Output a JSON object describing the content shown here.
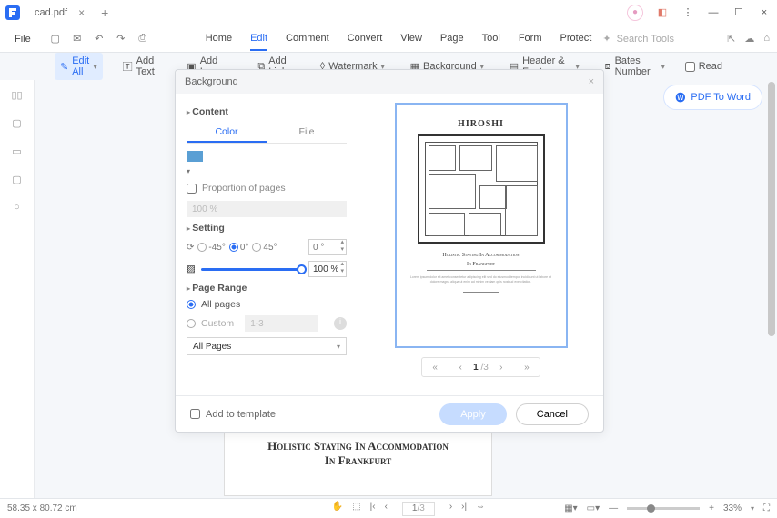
{
  "titlebar": {
    "filename": "cad.pdf"
  },
  "menu": {
    "file": "File"
  },
  "tabs": {
    "home": "Home",
    "edit": "Edit",
    "comment": "Comment",
    "convert": "Convert",
    "view": "View",
    "page": "Page",
    "tool": "Tool",
    "form": "Form",
    "protect": "Protect",
    "active": "edit"
  },
  "search_placeholder": "Search Tools",
  "toolbar": {
    "edit_all": "Edit All",
    "add_text": "Add Text",
    "add_image": "Add Image",
    "add_link": "Add Link",
    "watermark": "Watermark",
    "background": "Background",
    "header_footer": "Header & Footer",
    "bates_number": "Bates Number",
    "read": "Read"
  },
  "pdf_to_word": "PDF To Word",
  "doc": {
    "title_line1": "Holistic Staying In Accommodation",
    "title_line2": "In Frankfurt"
  },
  "modal": {
    "title": "Background",
    "content_h": "Content",
    "tab_color": "Color",
    "tab_file": "File",
    "proportion": "Proportion of pages",
    "proportion_val": "100  %",
    "setting_h": "Setting",
    "rot_m45": "-45°",
    "rot_0": "0°",
    "rot_45": "45°",
    "rot_val": "0 °",
    "scale_val": "100 %",
    "range_h": "Page Range",
    "all_pages": "All pages",
    "custom": "Custom",
    "custom_val": "1-3",
    "select_val": "All Pages",
    "pager_cur": "1",
    "pager_total": "/3",
    "add_template": "Add to template",
    "apply": "Apply",
    "cancel": "Cancel",
    "preview": {
      "title": "HIROSHI",
      "sub1": "Holistic Staying In Accommodation",
      "sub2": "In Frankfurt"
    }
  },
  "status": {
    "dims": "58.35 x 80.72 cm",
    "page_cur": "1",
    "page_total": "/3",
    "zoom": "33%"
  }
}
